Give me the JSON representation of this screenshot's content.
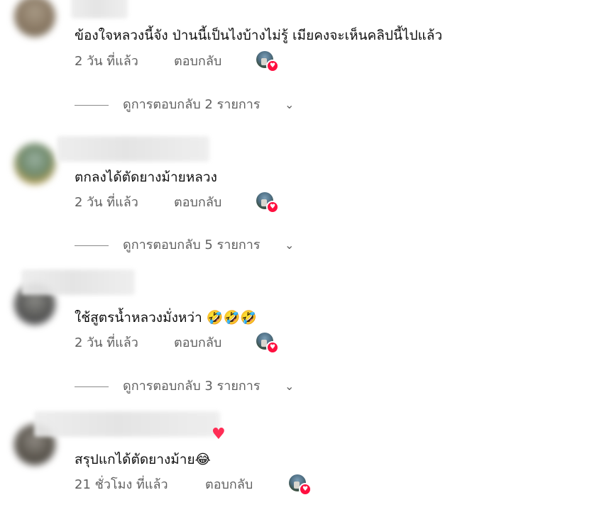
{
  "comments": [
    {
      "text": "ข้องใจหลวงนี้จัง ป่านนี้เป็นไงบ้างไม่รู้ เมียคงจะเห็นคลิปนี้ไปแล้ว",
      "time": "2 วัน ที่แล้ว",
      "reply_label": "ตอบกลับ",
      "view_replies": "ดูการตอบกลับ 2 รายการ",
      "creator_heart": "heart-icon"
    },
    {
      "text": "ตกลงได้ตัดยางม้ายหลวง",
      "time": "2 วัน ที่แล้ว",
      "reply_label": "ตอบกลับ",
      "view_replies": "ดูการตอบกลับ 5 รายการ",
      "creator_heart": "heart-icon"
    },
    {
      "text": "ใช้สูตรน้ำหลวงมั่งหว่า 🤣🤣🤣",
      "time": "2 วัน ที่แล้ว",
      "reply_label": "ตอบกลับ",
      "view_replies": "ดูการตอบกลับ 3 รายการ",
      "creator_heart": "heart-icon"
    },
    {
      "text": "สรุปแกได้ตัดยางม้าย😂",
      "time": "21 ชั่วโมง ที่แล้ว",
      "reply_label": "ตอบกลับ",
      "creator_heart": "heart-icon"
    }
  ],
  "colors": {
    "text": "#0f0f0f",
    "meta": "#606060",
    "heart": "#ff0f3f"
  },
  "icons": {
    "chevron": "chevron-down-icon",
    "heart": "heart-icon"
  }
}
